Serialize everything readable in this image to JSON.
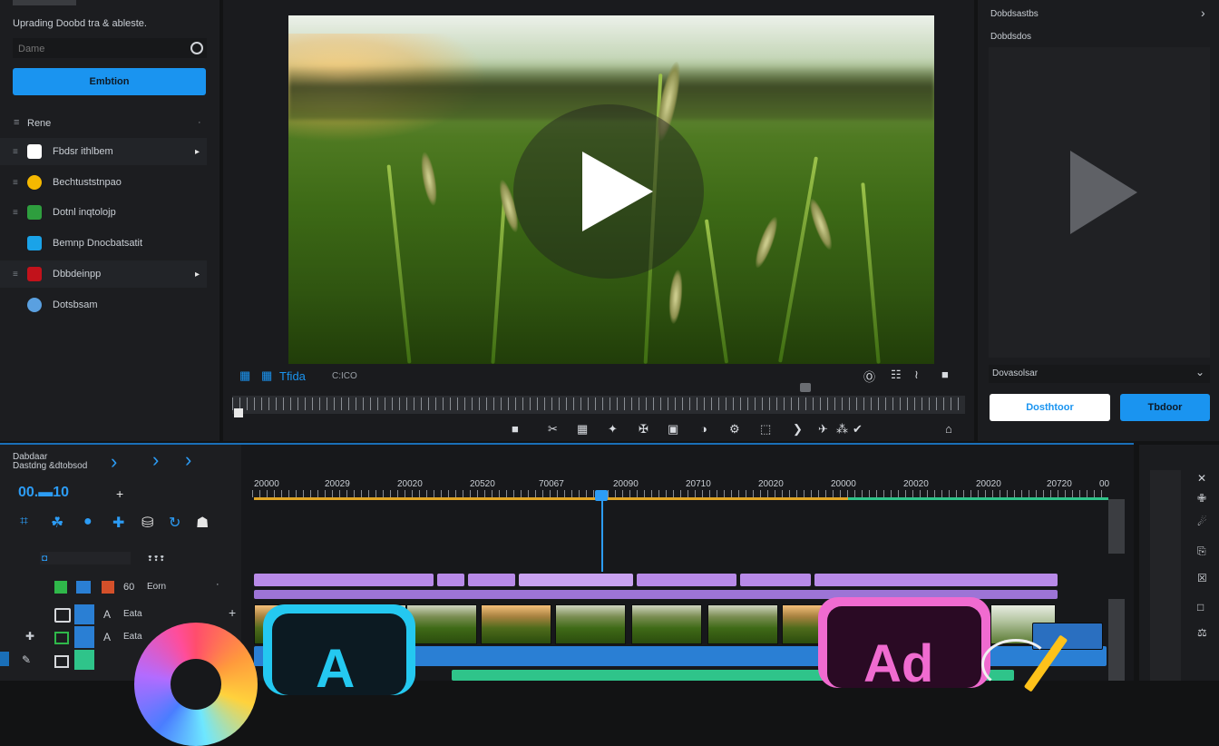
{
  "left_panel": {
    "title": "Uprading Doobd tra & ableste.",
    "search_placeholder": "Dame",
    "primary_button": "Embtion",
    "section_label": "Rene",
    "items": [
      {
        "label": "Fbdsr ithlbem",
        "icon_color": "#ffffff",
        "has_arrow": true
      },
      {
        "label": "Bechtuststnpao",
        "icon_color": "#f5b800",
        "has_arrow": false
      },
      {
        "label": "Dotnl inqtolojp",
        "icon_color": "#2e9e3e",
        "has_arrow": false
      },
      {
        "label": "Bemnp Dnocbatsatit",
        "icon_color": "#1aa3e8",
        "has_arrow": false
      },
      {
        "label": "Dbbdeinpp",
        "icon_color": "#c2121b",
        "has_arrow": true
      },
      {
        "label": "Dotsbsam",
        "icon_color": "#5aa0e0",
        "has_arrow": false
      }
    ],
    "arrow_glyph": "▸"
  },
  "viewer": {
    "view_label": "Tfida",
    "timecode": "C:ICO",
    "top_icons": [
      "circle-icon",
      "grid-icon",
      "wave-icon",
      "folder-icon"
    ],
    "top_icon_glyphs": [
      "Ⓞ",
      "☷",
      "≀",
      "■"
    ],
    "tool_icon_glyphs": [
      "■",
      "✂",
      "▦",
      "✦",
      "✠",
      "▣",
      "◑",
      "⚙",
      "⬚",
      "❯",
      "✈",
      "⁂",
      "✔"
    ],
    "end_icon_glyph": "⌂"
  },
  "right_panel": {
    "title": "Dobdsastbs",
    "subtitle": "Dobdsdos",
    "dropdown_value": "Dovasolsar",
    "secondary_button": "Dosthtoor",
    "primary_button": "Tbdoor",
    "close_glyph": "›",
    "dropdown_glyph": "⌄"
  },
  "timeline": {
    "header_line1": "Dabdaar",
    "header_line2": "Dastdng &dtobsod",
    "nav_glyph": "›",
    "timecode": "00.▬10",
    "add_glyph": "+",
    "tool_glyphs": [
      "⌗",
      "☘",
      "●",
      "✚",
      "⛁",
      "↻",
      "☗"
    ],
    "track1": {
      "icon": "◘",
      "label": "❢❢❢"
    },
    "track2": {
      "label1": "60",
      "label2": "Eorn"
    },
    "track3": {
      "label1": "A",
      "label2": "Eata"
    },
    "ruler_ticks": [
      "20000",
      "20029",
      "20020",
      "20520",
      "70067",
      "20090",
      "20710",
      "20020",
      "20000",
      "20020",
      "20020",
      "20720",
      "00"
    ],
    "track_side_glyphs": [
      "⬤",
      "─",
      "░"
    ]
  },
  "far_right": {
    "icons": [
      "✕",
      "✙",
      "☄",
      "⎘",
      "☒",
      "□",
      "⚖"
    ]
  },
  "colors": {
    "accent": "#1a94f0",
    "clip_purple": "#b88ae8",
    "clip_blue": "#2a7fd4",
    "clip_green": "#2fc48a",
    "playhead": "#2c9cf5"
  }
}
